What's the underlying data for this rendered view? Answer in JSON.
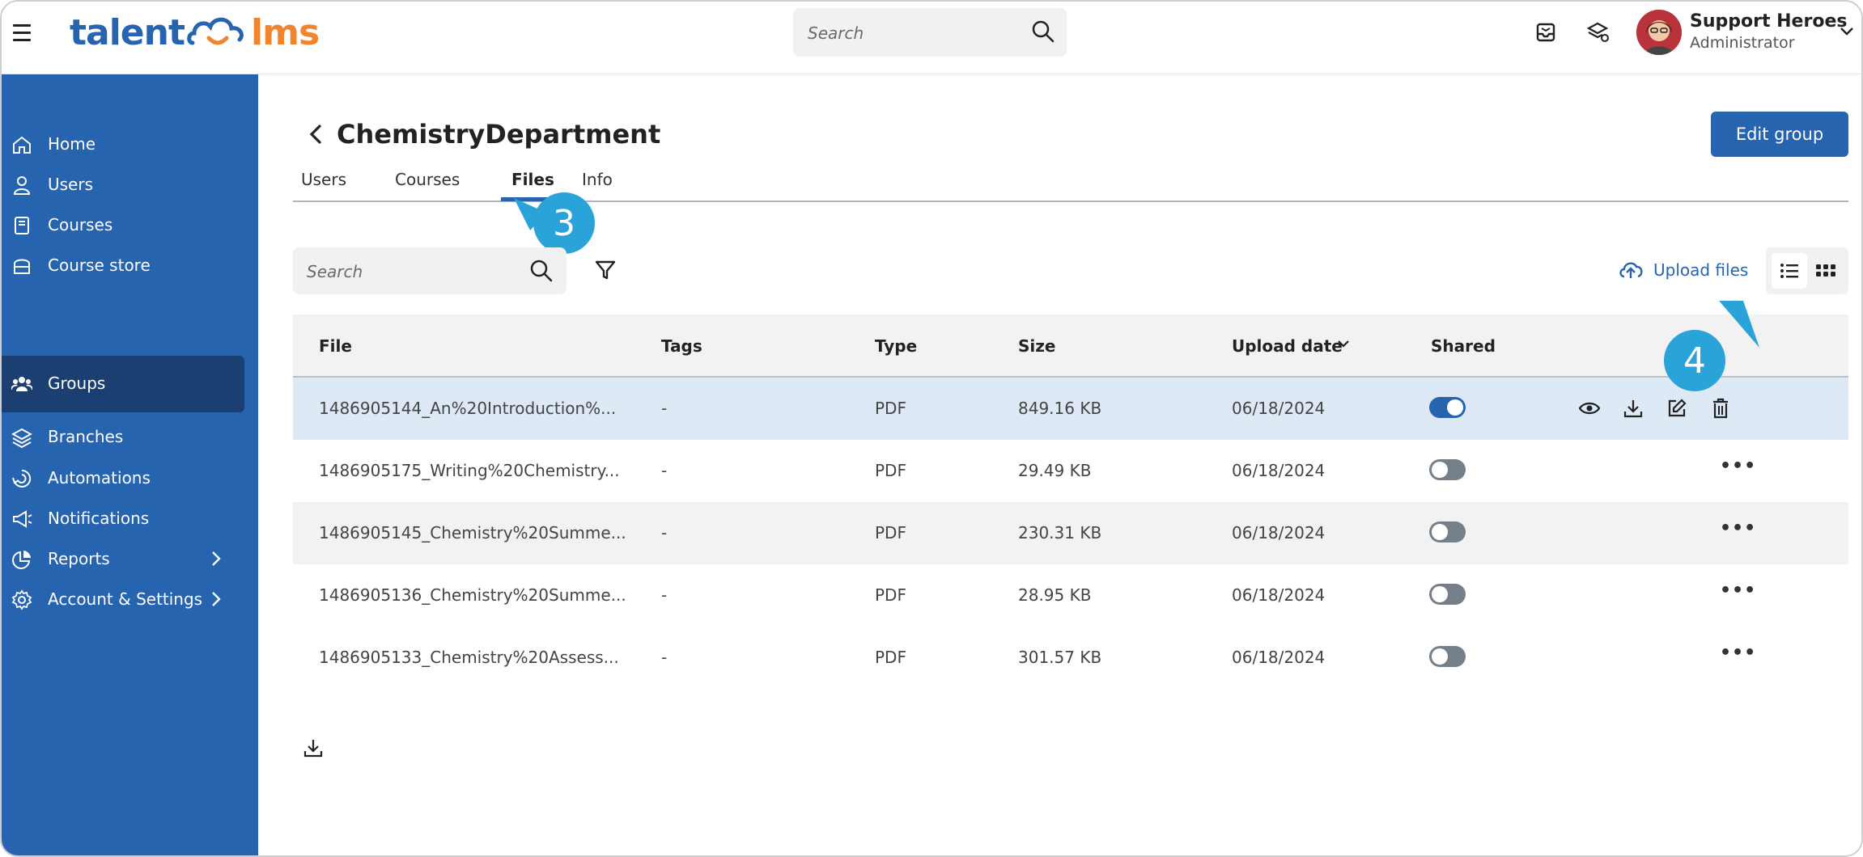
{
  "header": {
    "logo_left": "talent",
    "logo_right": "lms",
    "search_placeholder": "Search",
    "user_name": "Support Heroes",
    "user_role": "Administrator"
  },
  "sidebar": {
    "items": [
      {
        "label": "Home",
        "icon": "home-icon"
      },
      {
        "label": "Users",
        "icon": "user-icon"
      },
      {
        "label": "Courses",
        "icon": "book-icon"
      },
      {
        "label": "Course store",
        "icon": "store-icon"
      },
      {
        "label": "Groups",
        "icon": "groups-icon",
        "active": true
      },
      {
        "label": "Branches",
        "icon": "layers-icon"
      },
      {
        "label": "Automations",
        "icon": "automation-icon"
      },
      {
        "label": "Notifications",
        "icon": "megaphone-icon"
      },
      {
        "label": "Reports",
        "icon": "pie-chart-icon",
        "has_submenu": true
      },
      {
        "label": "Account & Settings",
        "icon": "gear-icon",
        "has_submenu": true
      }
    ]
  },
  "page": {
    "title": "ChemistryDepartment",
    "edit_label": "Edit group",
    "tabs": [
      {
        "label": "Users"
      },
      {
        "label": "Courses"
      },
      {
        "label": "Files",
        "active": true
      },
      {
        "label": "Info"
      }
    ],
    "callout_tab": "3",
    "callout_actions": "4",
    "files_search_placeholder": "Search",
    "upload_label": "Upload files"
  },
  "table": {
    "columns": [
      "File",
      "Tags",
      "Type",
      "Size",
      "Upload date",
      "Shared"
    ],
    "sort_column": "Upload date",
    "rows": [
      {
        "file": "1486905144_An%20Introduction%...",
        "tags": "-",
        "type": "PDF",
        "size": "849.16 KB",
        "date": "06/18/2024",
        "shared": true,
        "selected": true
      },
      {
        "file": "1486905175_Writing%20Chemistry...",
        "tags": "-",
        "type": "PDF",
        "size": "29.49 KB",
        "date": "06/18/2024",
        "shared": false
      },
      {
        "file": "1486905145_Chemistry%20Summe...",
        "tags": "-",
        "type": "PDF",
        "size": "230.31 KB",
        "date": "06/18/2024",
        "shared": false
      },
      {
        "file": "1486905136_Chemistry%20Summe...",
        "tags": "-",
        "type": "PDF",
        "size": "28.95 KB",
        "date": "06/18/2024",
        "shared": false
      },
      {
        "file": "1486905133_Chemistry%20Assess...",
        "tags": "-",
        "type": "PDF",
        "size": "301.57 KB",
        "date": "06/18/2024",
        "shared": false
      }
    ],
    "more_glyph": "•••"
  },
  "colors": {
    "brand_blue": "#2764b0",
    "brand_orange": "#f0852d",
    "sidebar_active": "#1c3f72",
    "callout": "#2aa3d9",
    "selected_row": "#dde9f5"
  }
}
